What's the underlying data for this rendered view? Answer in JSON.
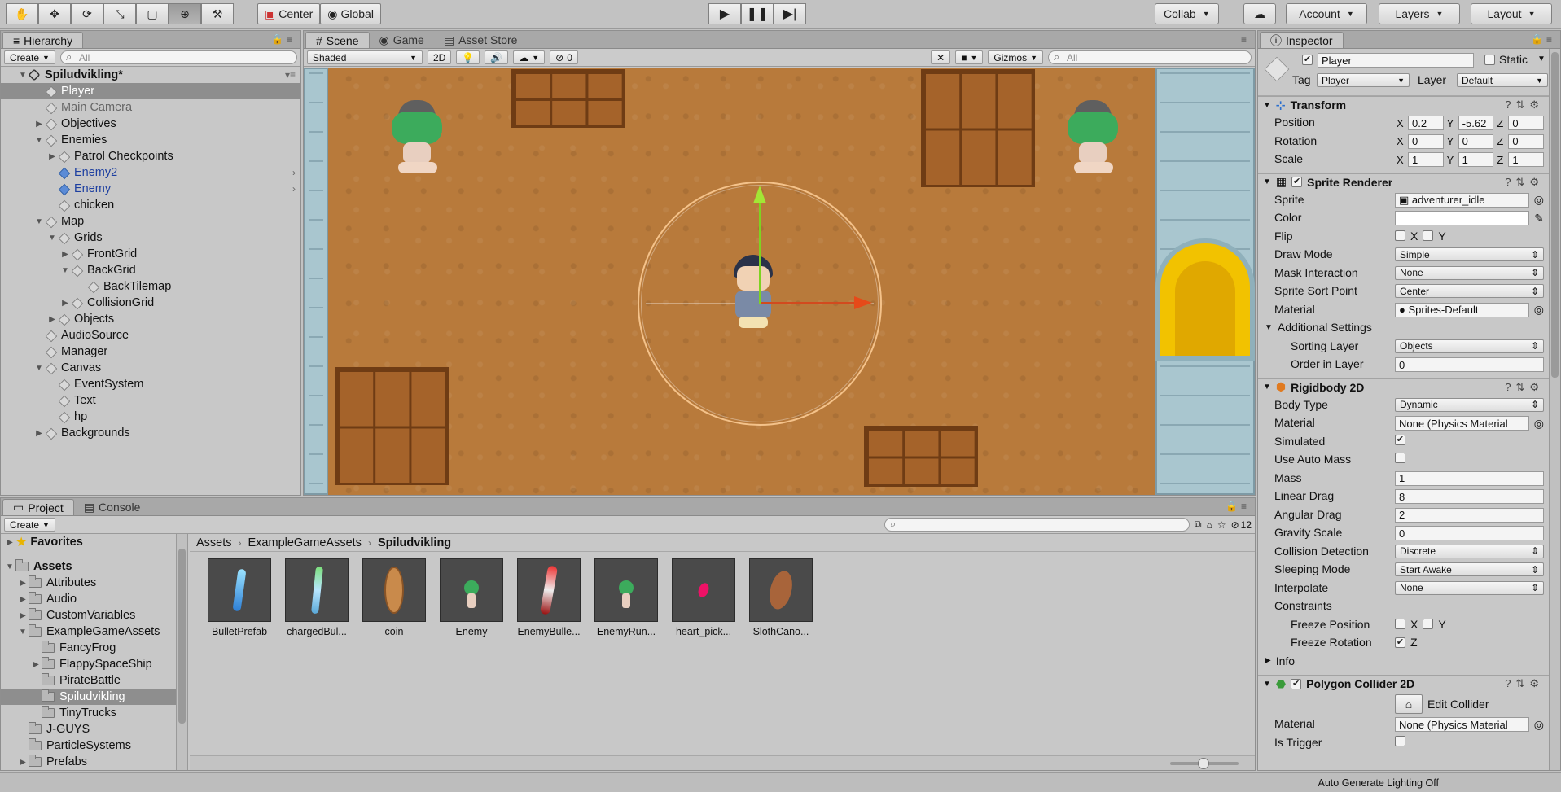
{
  "toolbar": {
    "pivot": "Center",
    "space": "Global",
    "collab": "Collab",
    "account": "Account",
    "layers": "Layers",
    "layout": "Layout"
  },
  "hierarchy": {
    "tab": "Hierarchy",
    "create": "Create",
    "search_placeholder": "All",
    "scene_name": "Spiludvikling*",
    "items": [
      {
        "label": "Player"
      },
      {
        "label": "Main Camera"
      },
      {
        "label": "Objectives"
      },
      {
        "label": "Enemies"
      },
      {
        "label": "Patrol Checkpoints"
      },
      {
        "label": "Enemy2"
      },
      {
        "label": "Enemy"
      },
      {
        "label": "chicken"
      },
      {
        "label": "Map"
      },
      {
        "label": "Grids"
      },
      {
        "label": "FrontGrid"
      },
      {
        "label": "BackGrid"
      },
      {
        "label": "BackTilemap"
      },
      {
        "label": "CollisionGrid"
      },
      {
        "label": "Objects"
      },
      {
        "label": "AudioSource"
      },
      {
        "label": "Manager"
      },
      {
        "label": "Canvas"
      },
      {
        "label": "EventSystem"
      },
      {
        "label": "Text"
      },
      {
        "label": "hp"
      },
      {
        "label": "Backgrounds"
      }
    ]
  },
  "scene": {
    "tabs": [
      "Scene",
      "Game",
      "Asset Store"
    ],
    "shading": "Shaded",
    "mode_2d": "2D",
    "hidden_count": "0",
    "gizmos": "Gizmos",
    "search_placeholder": "All"
  },
  "inspector": {
    "tab": "Inspector",
    "name": "Player",
    "static_label": "Static",
    "tag_label": "Tag",
    "tag": "Player",
    "layer_label": "Layer",
    "layer": "Default",
    "transform": {
      "title": "Transform",
      "position_label": "Position",
      "rotation_label": "Rotation",
      "scale_label": "Scale",
      "position": {
        "x": "0.2",
        "y": "-5.62",
        "z": "0"
      },
      "rotation": {
        "x": "0",
        "y": "0",
        "z": "0"
      },
      "scale": {
        "x": "1",
        "y": "1",
        "z": "1"
      }
    },
    "sprite_renderer": {
      "title": "Sprite Renderer",
      "sprite_label": "Sprite",
      "sprite": "adventurer_idle",
      "color_label": "Color",
      "flip_label": "Flip",
      "draw_mode_label": "Draw Mode",
      "draw_mode": "Simple",
      "mask_label": "Mask Interaction",
      "mask": "None",
      "sort_point_label": "Sprite Sort Point",
      "sort_point": "Center",
      "material_label": "Material",
      "material": "Sprites-Default",
      "additional_label": "Additional Settings",
      "sorting_layer_label": "Sorting Layer",
      "sorting_layer": "Objects",
      "order_label": "Order in Layer",
      "order": "0"
    },
    "rigidbody": {
      "title": "Rigidbody 2D",
      "body_type_label": "Body Type",
      "body_type": "Dynamic",
      "material_label": "Material",
      "material": "None (Physics Material",
      "simulated_label": "Simulated",
      "auto_mass_label": "Use Auto Mass",
      "mass_label": "Mass",
      "mass": "1",
      "linear_drag_label": "Linear Drag",
      "linear_drag": "8",
      "angular_drag_label": "Angular Drag",
      "angular_drag": "2",
      "gravity_label": "Gravity Scale",
      "gravity": "0",
      "collision_label": "Collision Detection",
      "collision": "Discrete",
      "sleeping_label": "Sleeping Mode",
      "sleeping": "Start Awake",
      "interpolate_label": "Interpolate",
      "interpolate": "None",
      "constraints_label": "Constraints",
      "freeze_pos_label": "Freeze Position",
      "freeze_rot_label": "Freeze Rotation",
      "info_label": "Info"
    },
    "polygon": {
      "title": "Polygon Collider 2D",
      "edit_label": "Edit Collider",
      "material_label": "Material",
      "material": "None (Physics Material",
      "trigger_label": "Is Trigger"
    }
  },
  "project": {
    "tabs": [
      "Project",
      "Console"
    ],
    "create": "Create",
    "hidden_count": "12",
    "favorites": "Favorites",
    "assets_root": "Assets",
    "folders": [
      "Attributes",
      "Audio",
      "CustomVariables",
      "ExampleGameAssets",
      "FancyFrog",
      "FlappySpaceShip",
      "PirateBattle",
      "Spiludvikling",
      "TinyTrucks",
      "J-GUYS",
      "ParticleSystems",
      "Prefabs"
    ],
    "breadcrumb": [
      "Assets",
      "ExampleGameAssets",
      "Spiludvikling"
    ],
    "assets": [
      {
        "name": "BulletPrefab"
      },
      {
        "name": "chargedBul..."
      },
      {
        "name": "coin"
      },
      {
        "name": "Enemy"
      },
      {
        "name": "EnemyBulle..."
      },
      {
        "name": "EnemyRun..."
      },
      {
        "name": "heart_pick..."
      },
      {
        "name": "SlothCano..."
      }
    ]
  },
  "status": {
    "text": "Auto Generate Lighting Off"
  }
}
